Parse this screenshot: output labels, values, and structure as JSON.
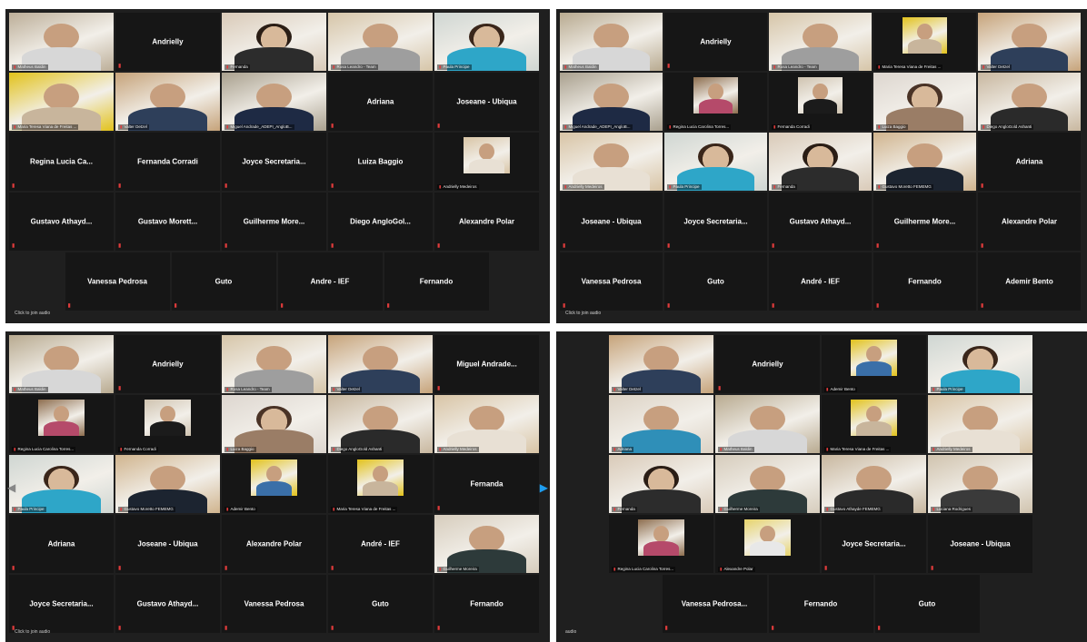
{
  "colors": {
    "highlight": "#d9e86a",
    "mic_muted": "#e03b3b",
    "arrow": "#1e9df0"
  },
  "panels": [
    {
      "join_audio": "Click to join audio",
      "rows": [
        [
          {
            "video": true,
            "hl": false,
            "caption": "Matheus Baldin",
            "tone": "#bcae98",
            "shirt": "#d7d7d7"
          },
          {
            "video": false,
            "name": "Andrielly"
          },
          {
            "video": true,
            "caption": "Fernanda",
            "tone": "#d9cab8",
            "shirt": "#2c2c2c",
            "hair": "#2a1d15"
          },
          {
            "video": true,
            "caption": "Rosa Leandro - Team",
            "tone": "#d6c5a8",
            "shirt": "#9e9e9e"
          },
          {
            "video": true,
            "hl": true,
            "caption": "Paula Principe",
            "tone": "#cfd6d2",
            "shirt": "#2ea6c8",
            "hair": "#3a261a"
          }
        ],
        [
          {
            "video": true,
            "caption": "Maria Teresa Viana de Freitas ...",
            "tone": "#e2c21b",
            "shirt": "#c8b59c"
          },
          {
            "video": true,
            "caption": "Valter Detzel",
            "tone": "#c6a37a",
            "shirt": "#2e3f5a"
          },
          {
            "video": true,
            "caption": "Miguel Andrade_ADEPI_AngloB...",
            "tone": "#a9a08e",
            "shirt": "#1e2a44"
          },
          {
            "video": false,
            "name": "Adriana"
          },
          {
            "video": false,
            "name": "Joseane - Ubiqua"
          }
        ],
        [
          {
            "video": false,
            "name": "Regina Lucia Ca..."
          },
          {
            "video": false,
            "name": "Fernanda Corradi"
          },
          {
            "video": false,
            "name": "Joyce Secretaria..."
          },
          {
            "video": false,
            "name": "Luiza Baggio"
          },
          {
            "video": true,
            "small": true,
            "caption": "Andrielly Medeiros",
            "tone": "#d8c4a5",
            "shirt": "#e8e0d4"
          }
        ],
        [
          {
            "video": false,
            "name": "Gustavo Athayd..."
          },
          {
            "video": false,
            "name": "Gustavo Morett..."
          },
          {
            "video": false,
            "name": "Guilherme More..."
          },
          {
            "video": false,
            "name": "Diego AngloGol..."
          },
          {
            "video": false,
            "name": "Alexandre Polar"
          }
        ],
        [
          {
            "video": false,
            "name": "Vanessa Pedrosa"
          },
          {
            "video": false,
            "name": "Guto"
          },
          {
            "video": false,
            "name": "Andre - IEF"
          },
          {
            "video": false,
            "name": "Fernando"
          }
        ]
      ]
    },
    {
      "join_audio": "Click to join audio",
      "rows": [
        [
          {
            "video": true,
            "hl": true,
            "caption": "Matheus Baldin",
            "tone": "#b8aa90",
            "shirt": "#d7d7d7"
          },
          {
            "video": false,
            "name": "Andrielly"
          },
          {
            "video": true,
            "caption": "Rosa Leandro - Team",
            "tone": "#d6c5a8",
            "shirt": "#9e9e9e"
          },
          {
            "video": true,
            "small": true,
            "caption": "Maria Teresa Viana de Freitas ...",
            "tone": "#e2c21b",
            "shirt": "#c8b59c"
          },
          {
            "video": true,
            "caption": "Valter Detzel",
            "tone": "#c6a37a",
            "shirt": "#2e3f5a"
          }
        ],
        [
          {
            "video": true,
            "caption": "Miguel Andrade_ADEPI_AngloB...",
            "tone": "#a9a08e",
            "shirt": "#1e2a44"
          },
          {
            "video": true,
            "small": true,
            "caption": "Regina Lucia Carolina Torres...",
            "tone": "#8d6d4e",
            "shirt": "#b54a6a"
          },
          {
            "video": true,
            "small": true,
            "caption": "Fernanda Corradi",
            "tone": "#cfc3b0",
            "shirt": "#1b1b1b"
          },
          {
            "video": true,
            "caption": "Luiza Baggio",
            "tone": "#ddd6cf",
            "shirt": "#9a7d66",
            "hair": "#4a3326"
          },
          {
            "video": true,
            "caption": "Diego AngloGold Ashanti",
            "tone": "#c8b79f",
            "shirt": "#2a2a2a"
          }
        ],
        [
          {
            "video": true,
            "caption": "Andrielly Medeiros",
            "tone": "#d8c4a5",
            "shirt": "#e8e0d4"
          },
          {
            "video": true,
            "caption": "Paula Principe",
            "tone": "#cfd6d2",
            "shirt": "#2ea6c8",
            "hair": "#3a261a"
          },
          {
            "video": true,
            "caption": "Fernanda",
            "tone": "#d9cab8",
            "shirt": "#2c2c2c",
            "hair": "#2a1d15"
          },
          {
            "video": true,
            "caption": "Gustavo Moretto FEMEMG",
            "tone": "#d0b48e",
            "shirt": "#1c2430"
          },
          {
            "video": false,
            "name": "Adriana"
          }
        ],
        [
          {
            "video": false,
            "name": "Joseane - Ubiqua"
          },
          {
            "video": false,
            "name": "Joyce Secretaria..."
          },
          {
            "video": false,
            "name": "Gustavo Athayd..."
          },
          {
            "video": false,
            "name": "Guilherme More..."
          },
          {
            "video": false,
            "name": "Alexandre Polar"
          }
        ],
        [
          {
            "video": false,
            "name": "Vanessa Pedrosa"
          },
          {
            "video": false,
            "name": "Guto"
          },
          {
            "video": false,
            "name": "André - IEF"
          },
          {
            "video": false,
            "name": "Fernando"
          },
          {
            "video": false,
            "name": "Ademir Bento"
          }
        ]
      ]
    },
    {
      "join_audio": "Click to join audio",
      "rows": [
        [
          {
            "video": true,
            "hl": true,
            "caption": "Matheus Baldin",
            "tone": "#b8aa90",
            "shirt": "#d7d7d7"
          },
          {
            "video": false,
            "name": "Andrielly"
          },
          {
            "video": true,
            "caption": "Rosa Leandro - Team",
            "tone": "#d6c5a8",
            "shirt": "#9e9e9e"
          },
          {
            "video": true,
            "caption": "Valter Detzel",
            "tone": "#c6a37a",
            "shirt": "#2e3f5a"
          },
          {
            "video": false,
            "name": "Miguel Andrade..."
          }
        ],
        [
          {
            "video": true,
            "small": true,
            "caption": "Regina Lucia Carolina Torres...",
            "tone": "#8d6d4e",
            "shirt": "#b54a6a"
          },
          {
            "video": true,
            "small": true,
            "caption": "Fernanda Corradi",
            "tone": "#cfc3b0",
            "shirt": "#1b1b1b"
          },
          {
            "video": true,
            "caption": "Luiza Baggio",
            "tone": "#ddd6cf",
            "shirt": "#9a7d66",
            "hair": "#4a3326"
          },
          {
            "video": true,
            "caption": "Diego AngloGold Ashanti",
            "tone": "#c8b79f",
            "shirt": "#2a2a2a"
          },
          {
            "video": true,
            "caption": "Andrielly Medeiros",
            "tone": "#d8c4a5",
            "shirt": "#e8e0d4"
          }
        ],
        [
          {
            "video": true,
            "caption": "Paula Principe",
            "tone": "#cfd6d2",
            "shirt": "#2ea6c8",
            "hair": "#3a261a"
          },
          {
            "video": true,
            "caption": "Gustavo Moretto FEMEMG",
            "tone": "#d0b48e",
            "shirt": "#1c2430"
          },
          {
            "video": true,
            "small": true,
            "caption": "Ademir Bento",
            "tone": "#e2c21b",
            "shirt": "#3a6fa8"
          },
          {
            "video": true,
            "small": true,
            "caption": "Maria Teresa Viana de Freitas ...",
            "tone": "#e2c21b",
            "shirt": "#c8b59c"
          },
          {
            "video": false,
            "name": "Fernanda"
          }
        ],
        [
          {
            "video": false,
            "name": "Adriana"
          },
          {
            "video": false,
            "name": "Joseane - Ubiqua"
          },
          {
            "video": false,
            "name": "Alexandre Polar"
          },
          {
            "video": false,
            "name": "André - IEF"
          },
          {
            "video": true,
            "caption": "Guilherme Moreira",
            "tone": "#d6ccbc",
            "shirt": "#2d3a3a"
          }
        ],
        [
          {
            "video": false,
            "name": "Joyce Secretaria..."
          },
          {
            "video": false,
            "name": "Gustavo Athayd..."
          },
          {
            "video": false,
            "name": "Vanessa Pedrosa"
          },
          {
            "video": false,
            "name": "Guto"
          },
          {
            "video": false,
            "name": "Fernando"
          }
        ]
      ]
    },
    {
      "join_audio": "audio",
      "rows": [
        [
          {
            "video": true,
            "hl": true,
            "caption": "Valter Detzel",
            "tone": "#c6a37a",
            "shirt": "#2e3f5a"
          },
          {
            "video": false,
            "name": "Andrielly"
          },
          {
            "video": true,
            "small": true,
            "caption": "Ademir Bento",
            "tone": "#e2c21b",
            "shirt": "#3a6fa8"
          },
          {
            "video": true,
            "caption": "Paula Principe",
            "tone": "#cfd6d2",
            "shirt": "#2ea6c8",
            "hair": "#3a261a"
          }
        ],
        [
          {
            "video": true,
            "caption": "Adriana",
            "tone": "#dcd2c4",
            "shirt": "#2f8fb8"
          },
          {
            "video": true,
            "caption": "Matheus Baldin",
            "tone": "#b8aa90",
            "shirt": "#d7d7d7"
          },
          {
            "video": true,
            "small": true,
            "caption": "Maria Teresa Viana de Freitas ...",
            "tone": "#e2c21b",
            "shirt": "#c8b59c"
          },
          {
            "video": true,
            "caption": "Andrielly Medeiros",
            "tone": "#d8c4a5",
            "shirt": "#e8e0d4"
          }
        ],
        [
          {
            "video": true,
            "caption": "Fernanda",
            "tone": "#d9cab8",
            "shirt": "#2c2c2c",
            "hair": "#2a1d15"
          },
          {
            "video": true,
            "caption": "Guilherme Moreira",
            "tone": "#d6ccbc",
            "shirt": "#2d3a3a"
          },
          {
            "video": true,
            "caption": "Gustavo Athayde FEMEMG",
            "tone": "#c8b79f",
            "shirt": "#2a2a2a"
          },
          {
            "video": true,
            "caption": "Luciana Rodrigues",
            "tone": "#d0c3ae",
            "shirt": "#3a3a3a"
          }
        ],
        [
          {
            "video": true,
            "small": true,
            "caption": "Regina Lucia Carolina Torres...",
            "tone": "#8d6d4e",
            "shirt": "#b54a6a"
          },
          {
            "video": true,
            "small": true,
            "caption": "Alexandre Polar",
            "tone": "#e6d36a",
            "shirt": "#e8e8e8"
          },
          {
            "video": false,
            "name": "Joyce Secretaria..."
          },
          {
            "video": false,
            "name": "Joseane - Ubiqua"
          }
        ],
        [
          {
            "video": false,
            "name": "Vanessa Pedrosa..."
          },
          {
            "video": false,
            "name": "Fernando"
          },
          {
            "video": false,
            "name": "Guto"
          }
        ]
      ]
    }
  ]
}
